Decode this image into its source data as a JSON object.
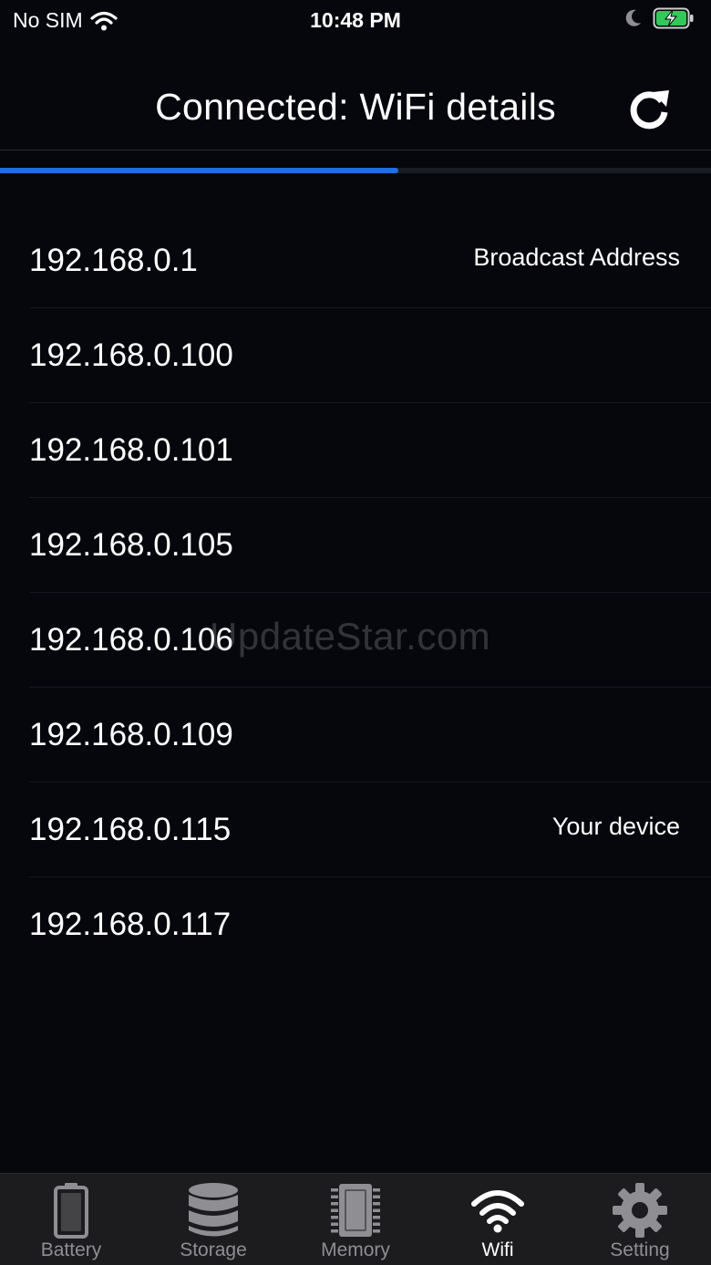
{
  "status_bar": {
    "carrier": "No SIM",
    "time": "10:48 PM",
    "battery_color": "#34c759"
  },
  "header": {
    "title": "Connected: WiFi details",
    "refresh_icon": "refresh-icon"
  },
  "scan_progress": 0.56,
  "devices": [
    {
      "ip": "192.168.0.1",
      "tag": "Broadcast Address"
    },
    {
      "ip": "192.168.0.100",
      "tag": ""
    },
    {
      "ip": "192.168.0.101",
      "tag": ""
    },
    {
      "ip": "192.168.0.105",
      "tag": ""
    },
    {
      "ip": "192.168.0.106",
      "tag": ""
    },
    {
      "ip": "192.168.0.109",
      "tag": ""
    },
    {
      "ip": "192.168.0.115",
      "tag": "Your device"
    },
    {
      "ip": "192.168.0.117",
      "tag": ""
    }
  ],
  "watermark": "UpdateStar.com",
  "tabs": [
    {
      "label": "Battery",
      "icon": "battery-icon",
      "active": false
    },
    {
      "label": "Storage",
      "icon": "storage-icon",
      "active": false
    },
    {
      "label": "Memory",
      "icon": "memory-chip-icon",
      "active": false
    },
    {
      "label": "Wifi",
      "icon": "wifi-icon",
      "active": true
    },
    {
      "label": "Setting",
      "icon": "gear-icon",
      "active": false
    }
  ],
  "colors": {
    "background": "#05070c",
    "accent": "#1f6fe0",
    "tab_inactive": "#8e8e93"
  }
}
